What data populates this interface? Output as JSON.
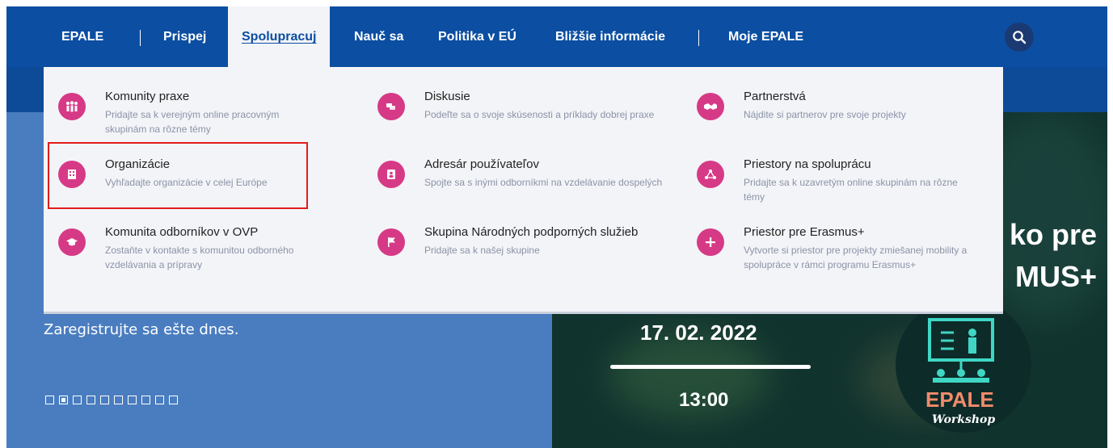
{
  "nav": {
    "items": [
      "EPALE",
      "Prispej",
      "Spolupracuj",
      "Nauč sa",
      "Politika v EÚ",
      "Bližšie informácie",
      "Moje EPALE"
    ]
  },
  "menu": {
    "items": [
      {
        "title": "Komunity praxe",
        "desc": "Pridajte sa k verejným online pracovným skupinám na rôzne témy",
        "icon": "people-group-icon"
      },
      {
        "title": "Diskusie",
        "desc": "Podeľte sa o svoje skúsenosti a príklady dobrej praxe",
        "icon": "chat-icon"
      },
      {
        "title": "Partnerstvá",
        "desc": "Nájdite si partnerov pre svoje projekty",
        "icon": "handshake-icon"
      },
      {
        "title": "Organizácie",
        "desc": "Vyhľadajte organizácie v celej Európe",
        "icon": "building-icon"
      },
      {
        "title": "Adresár používateľov",
        "desc": "Spojte sa s inými odborníkmi na vzdelávanie dospelých",
        "icon": "address-book-icon"
      },
      {
        "title": "Priestory na spoluprácu",
        "desc": "Pridajte sa k uzavretým online skupinám na rôzne témy",
        "icon": "network-icon"
      },
      {
        "title": "Komunita odborníkov v OVP",
        "desc": "Zostaňte v kontakte s komunitou odborného vzdelávania a prípravy",
        "icon": "graduation-cap-icon"
      },
      {
        "title": "Skupina Národných podporných služieb",
        "desc": "Pridajte sa k našej skupine",
        "icon": "flag-icon"
      },
      {
        "title": "Priestor pre Erasmus+",
        "desc": "Vytvorte si priestor pre projekty zmiešanej mobility a spolupráce v rámci programu Erasmus+",
        "icon": "plus-icon"
      }
    ]
  },
  "hero": {
    "register": "Zaregistrujte sa ešte dnes.",
    "title_line1": "ko pre",
    "title_line2": "MUS+",
    "date": "17. 02. 2022",
    "time": "13:00",
    "badge_epale": "EPALE",
    "badge_workshop": "Workshop",
    "slide_count": 10,
    "active_slide": 2
  },
  "colors": {
    "nav": "#0b4ea2",
    "accent_pink": "#d63a86",
    "highlight": "#e21b1b"
  }
}
